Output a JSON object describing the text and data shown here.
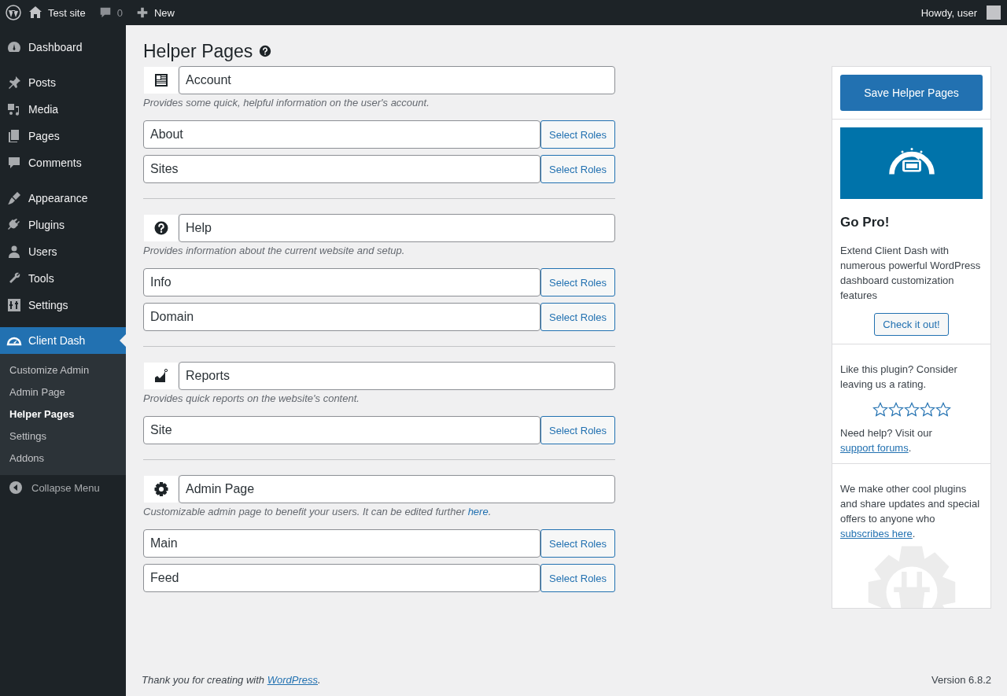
{
  "admin_bar": {
    "site": "Test site",
    "comments": "0",
    "new": "New",
    "greeting": "Howdy, user"
  },
  "menu_groups": [
    [
      {
        "kind": "dashboard",
        "label": "Dashboard",
        "selected": false
      }
    ],
    [
      {
        "kind": "posts",
        "label": "Posts",
        "selected": false
      },
      {
        "kind": "media",
        "label": "Media",
        "selected": false
      },
      {
        "kind": "pages",
        "label": "Pages",
        "selected": false
      },
      {
        "kind": "comments",
        "label": "Comments",
        "selected": false
      }
    ],
    [
      {
        "kind": "appearance",
        "label": "Appearance",
        "selected": false
      },
      {
        "kind": "plugins",
        "label": "Plugins",
        "selected": false
      },
      {
        "kind": "users",
        "label": "Users",
        "selected": false
      },
      {
        "kind": "tools",
        "label": "Tools",
        "selected": false
      },
      {
        "kind": "settings",
        "label": "Settings",
        "selected": false
      }
    ],
    [
      {
        "kind": "gauge",
        "label": "Client Dash",
        "selected": true,
        "children": [
          {
            "label": "Customize Admin",
            "selected": false
          },
          {
            "label": "Admin Page",
            "selected": false
          },
          {
            "label": "Helper Pages",
            "selected": true
          },
          {
            "label": "Settings",
            "selected": false
          },
          {
            "label": "Addons",
            "selected": false
          }
        ]
      }
    ]
  ],
  "collapse": "Collapse Menu",
  "page_title": "Helper Pages",
  "sections": [
    {
      "kind": "account",
      "title": "Account",
      "description": "Provides some quick, helpful information on the user's account.",
      "pages": [
        {
          "title": "About",
          "button": "Select Roles"
        },
        {
          "title": "Sites",
          "button": "Select Roles"
        }
      ]
    },
    {
      "kind": "help",
      "title": "Help",
      "description": "Provides information about the current website and setup.",
      "pages": [
        {
          "title": "Info",
          "button": "Select Roles"
        },
        {
          "title": "Domain",
          "button": "Select Roles"
        }
      ]
    },
    {
      "kind": "reports",
      "title": "Reports",
      "description": "Provides quick reports on the website's content.",
      "pages": [
        {
          "title": "Site",
          "button": "Select Roles"
        }
      ]
    },
    {
      "kind": "gear",
      "title": "Admin Page",
      "description": "Customizable admin page to benefit your users. It can be edited further ",
      "link": "here",
      "description_end": ".",
      "pages": [
        {
          "title": "Main",
          "button": "Select Roles"
        },
        {
          "title": "Feed",
          "button": "Select Roles"
        }
      ]
    }
  ],
  "sidebar": {
    "save": "Save Helper Pages",
    "promo_title": "Go Pro!",
    "promo_text": "Extend Client Dash with numerous powerful WordPress dashboard customization features",
    "promo_button": "Check it out!",
    "rating_text": "Like this plugin? Consider leaving us a rating.",
    "stars": 0,
    "help_text": "Need help? Visit our ",
    "help_link": "support forums",
    "help_end": ".",
    "subscribe_text": "We make other cool plugins and share updates and special offers to anyone who ",
    "subscribe_link": "subscribes here",
    "subscribe_end": "."
  },
  "footer": {
    "text": "Thank you for creating with ",
    "link": "WordPress",
    "end": ".",
    "version": "Version 6.8.2"
  }
}
